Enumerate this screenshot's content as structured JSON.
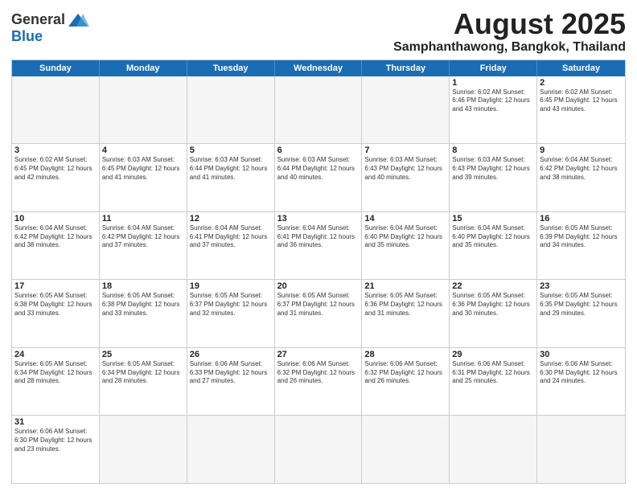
{
  "logo": {
    "general": "General",
    "blue": "Blue"
  },
  "title": "August 2025",
  "location": "Samphanthawong, Bangkok, Thailand",
  "headers": [
    "Sunday",
    "Monday",
    "Tuesday",
    "Wednesday",
    "Thursday",
    "Friday",
    "Saturday"
  ],
  "rows": [
    [
      {
        "day": "",
        "info": ""
      },
      {
        "day": "",
        "info": ""
      },
      {
        "day": "",
        "info": ""
      },
      {
        "day": "",
        "info": ""
      },
      {
        "day": "",
        "info": ""
      },
      {
        "day": "1",
        "info": "Sunrise: 6:02 AM\nSunset: 6:46 PM\nDaylight: 12 hours and 43 minutes."
      },
      {
        "day": "2",
        "info": "Sunrise: 6:02 AM\nSunset: 6:45 PM\nDaylight: 12 hours and 43 minutes."
      }
    ],
    [
      {
        "day": "3",
        "info": "Sunrise: 6:02 AM\nSunset: 6:45 PM\nDaylight: 12 hours and 42 minutes."
      },
      {
        "day": "4",
        "info": "Sunrise: 6:03 AM\nSunset: 6:45 PM\nDaylight: 12 hours and 41 minutes."
      },
      {
        "day": "5",
        "info": "Sunrise: 6:03 AM\nSunset: 6:44 PM\nDaylight: 12 hours and 41 minutes."
      },
      {
        "day": "6",
        "info": "Sunrise: 6:03 AM\nSunset: 6:44 PM\nDaylight: 12 hours and 40 minutes."
      },
      {
        "day": "7",
        "info": "Sunrise: 6:03 AM\nSunset: 6:43 PM\nDaylight: 12 hours and 40 minutes."
      },
      {
        "day": "8",
        "info": "Sunrise: 6:03 AM\nSunset: 6:43 PM\nDaylight: 12 hours and 39 minutes."
      },
      {
        "day": "9",
        "info": "Sunrise: 6:04 AM\nSunset: 6:42 PM\nDaylight: 12 hours and 38 minutes."
      }
    ],
    [
      {
        "day": "10",
        "info": "Sunrise: 6:04 AM\nSunset: 6:42 PM\nDaylight: 12 hours and 38 minutes."
      },
      {
        "day": "11",
        "info": "Sunrise: 6:04 AM\nSunset: 6:42 PM\nDaylight: 12 hours and 37 minutes."
      },
      {
        "day": "12",
        "info": "Sunrise: 6:04 AM\nSunset: 6:41 PM\nDaylight: 12 hours and 37 minutes."
      },
      {
        "day": "13",
        "info": "Sunrise: 6:04 AM\nSunset: 6:41 PM\nDaylight: 12 hours and 36 minutes."
      },
      {
        "day": "14",
        "info": "Sunrise: 6:04 AM\nSunset: 6:40 PM\nDaylight: 12 hours and 35 minutes."
      },
      {
        "day": "15",
        "info": "Sunrise: 6:04 AM\nSunset: 6:40 PM\nDaylight: 12 hours and 35 minutes."
      },
      {
        "day": "16",
        "info": "Sunrise: 6:05 AM\nSunset: 6:39 PM\nDaylight: 12 hours and 34 minutes."
      }
    ],
    [
      {
        "day": "17",
        "info": "Sunrise: 6:05 AM\nSunset: 6:38 PM\nDaylight: 12 hours and 33 minutes."
      },
      {
        "day": "18",
        "info": "Sunrise: 6:05 AM\nSunset: 6:38 PM\nDaylight: 12 hours and 33 minutes."
      },
      {
        "day": "19",
        "info": "Sunrise: 6:05 AM\nSunset: 6:37 PM\nDaylight: 12 hours and 32 minutes."
      },
      {
        "day": "20",
        "info": "Sunrise: 6:05 AM\nSunset: 6:37 PM\nDaylight: 12 hours and 31 minutes."
      },
      {
        "day": "21",
        "info": "Sunrise: 6:05 AM\nSunset: 6:36 PM\nDaylight: 12 hours and 31 minutes."
      },
      {
        "day": "22",
        "info": "Sunrise: 6:05 AM\nSunset: 6:36 PM\nDaylight: 12 hours and 30 minutes."
      },
      {
        "day": "23",
        "info": "Sunrise: 6:05 AM\nSunset: 6:35 PM\nDaylight: 12 hours and 29 minutes."
      }
    ],
    [
      {
        "day": "24",
        "info": "Sunrise: 6:05 AM\nSunset: 6:34 PM\nDaylight: 12 hours and 28 minutes."
      },
      {
        "day": "25",
        "info": "Sunrise: 6:05 AM\nSunset: 6:34 PM\nDaylight: 12 hours and 28 minutes."
      },
      {
        "day": "26",
        "info": "Sunrise: 6:06 AM\nSunset: 6:33 PM\nDaylight: 12 hours and 27 minutes."
      },
      {
        "day": "27",
        "info": "Sunrise: 6:06 AM\nSunset: 6:32 PM\nDaylight: 12 hours and 26 minutes."
      },
      {
        "day": "28",
        "info": "Sunrise: 6:06 AM\nSunset: 6:32 PM\nDaylight: 12 hours and 26 minutes."
      },
      {
        "day": "29",
        "info": "Sunrise: 6:06 AM\nSunset: 6:31 PM\nDaylight: 12 hours and 25 minutes."
      },
      {
        "day": "30",
        "info": "Sunrise: 6:06 AM\nSunset: 6:30 PM\nDaylight: 12 hours and 24 minutes."
      }
    ],
    [
      {
        "day": "31",
        "info": "Sunrise: 6:06 AM\nSunset: 6:30 PM\nDaylight: 12 hours and 23 minutes."
      },
      {
        "day": "",
        "info": ""
      },
      {
        "day": "",
        "info": ""
      },
      {
        "day": "",
        "info": ""
      },
      {
        "day": "",
        "info": ""
      },
      {
        "day": "",
        "info": ""
      },
      {
        "day": "",
        "info": ""
      }
    ]
  ]
}
